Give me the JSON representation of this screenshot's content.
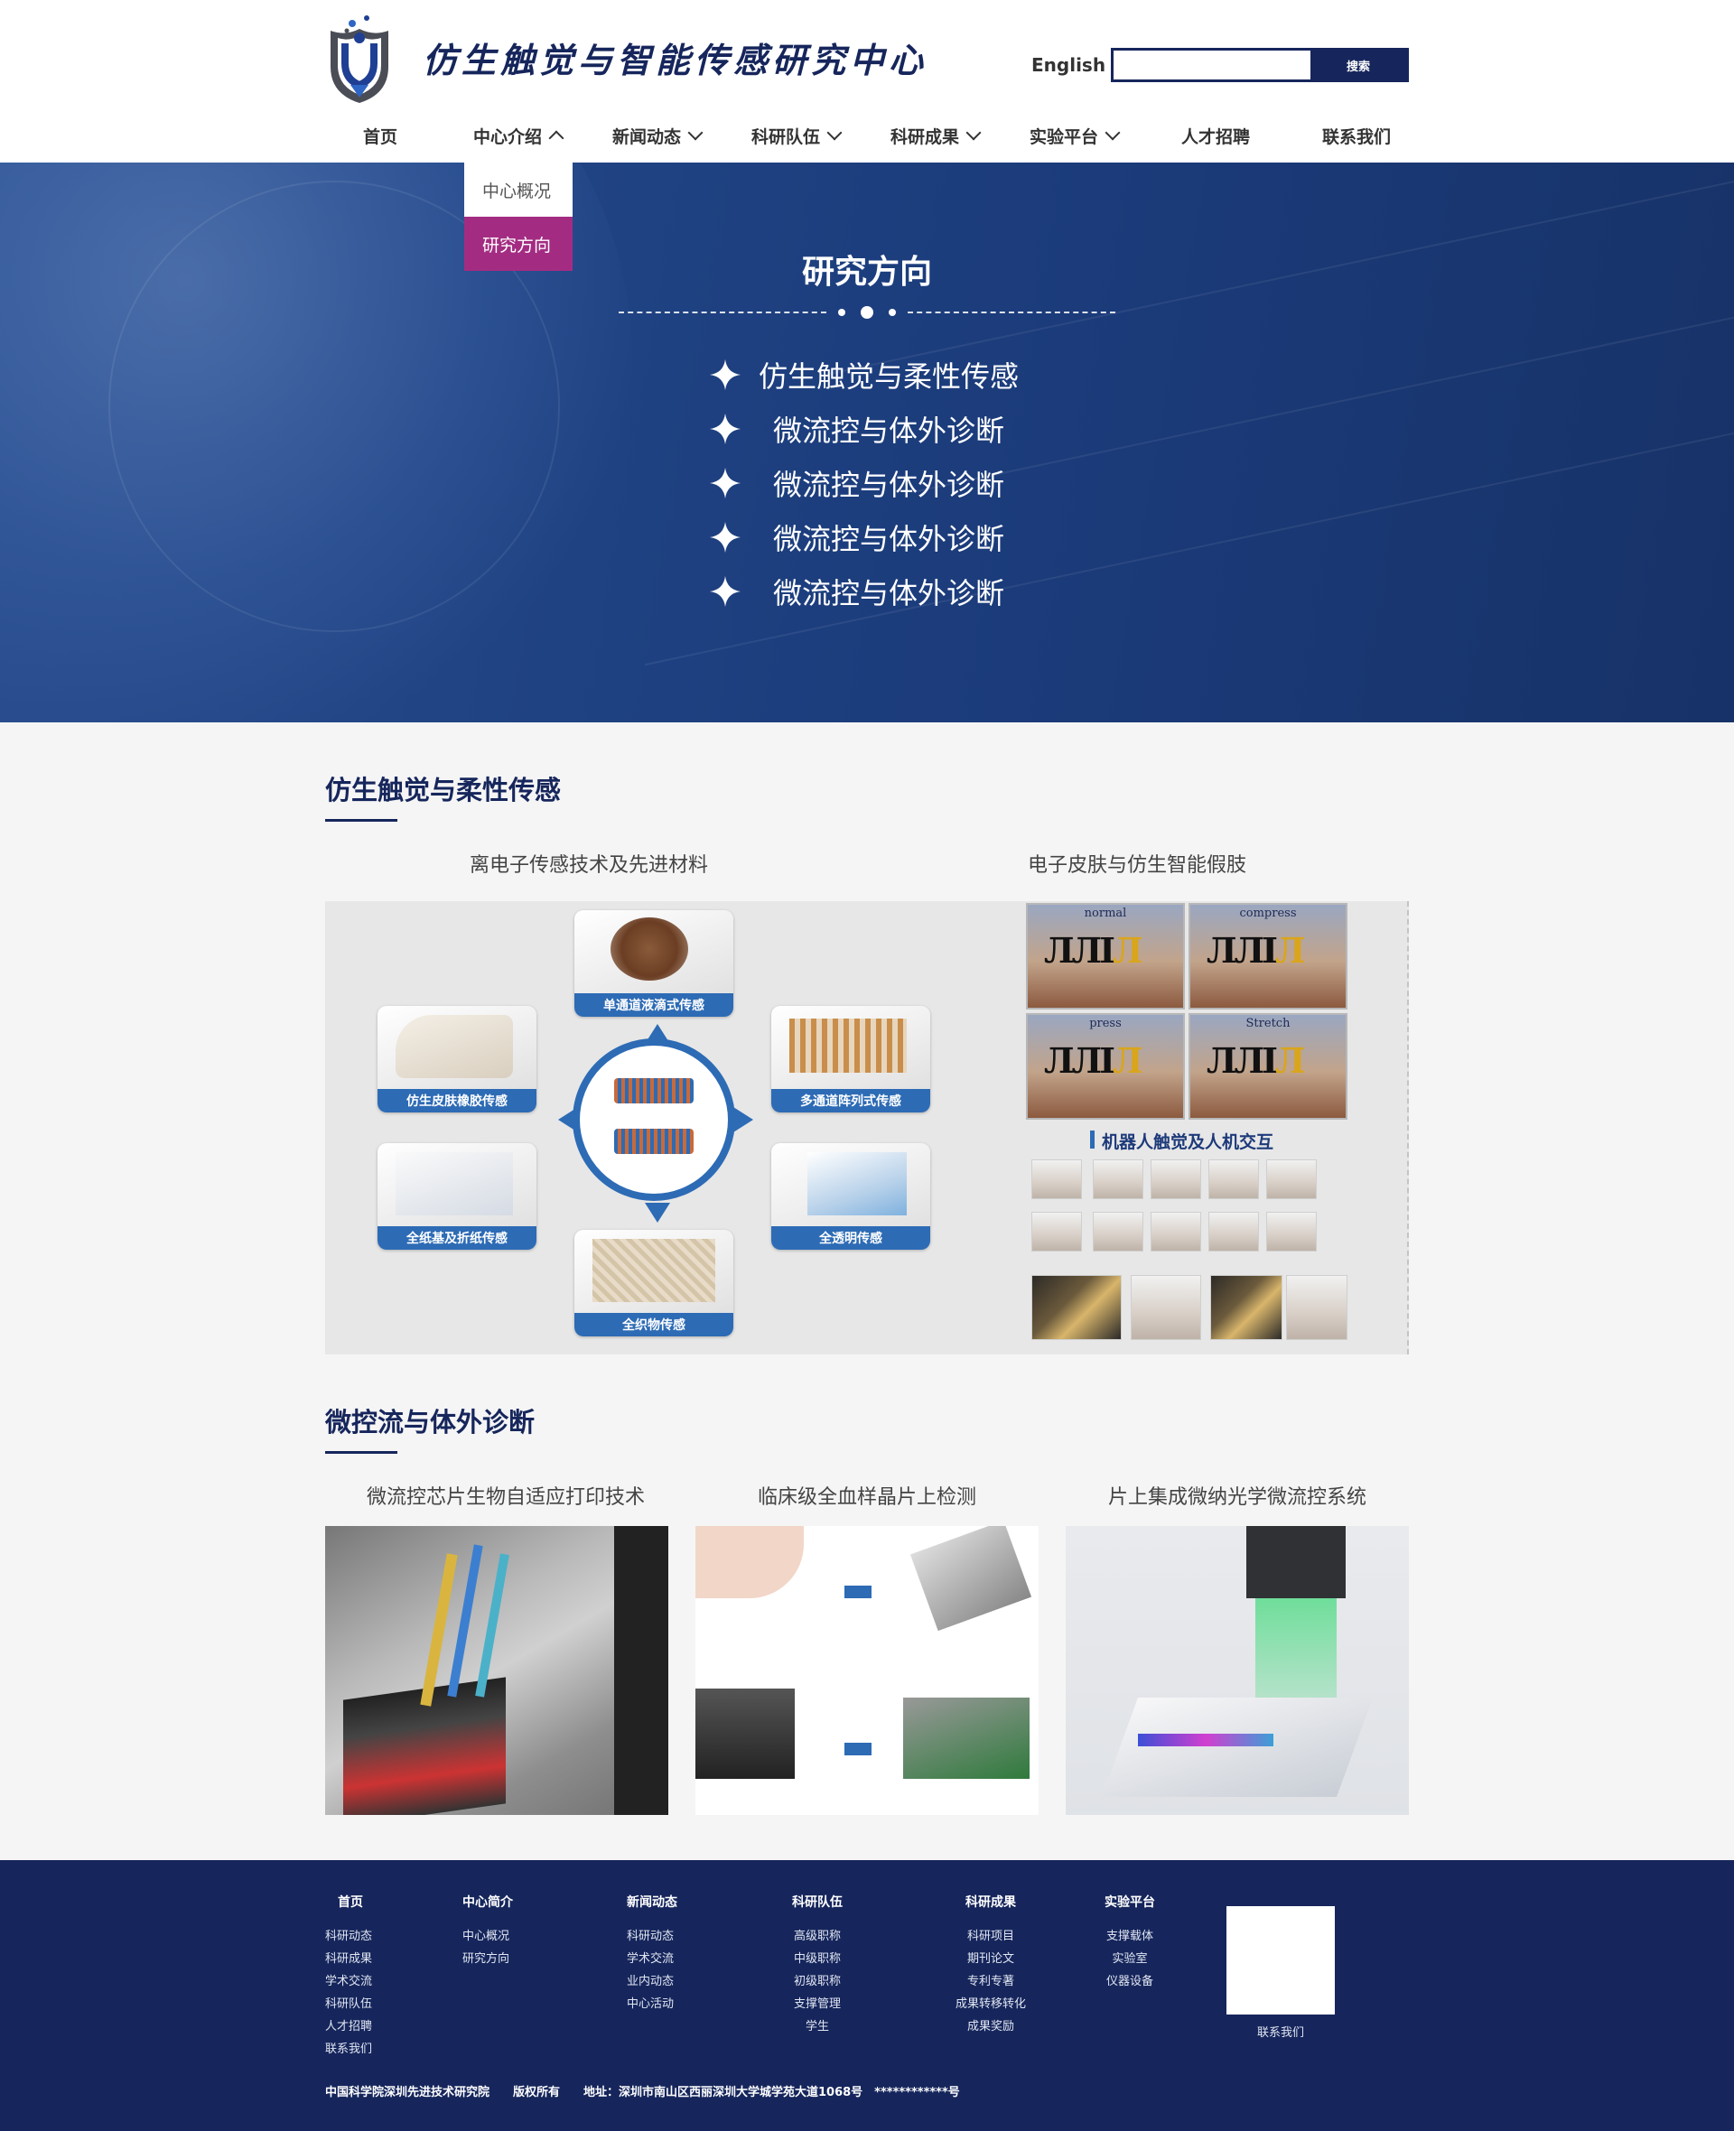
{
  "header": {
    "site_title": "仿生触觉与智能传感研究中心",
    "lang_link": "English",
    "search": {
      "value": "",
      "placeholder": "",
      "button_label": "搜索"
    }
  },
  "nav": {
    "items": [
      {
        "label": "首页",
        "has_dropdown": false
      },
      {
        "label": "中心介绍",
        "has_dropdown": true,
        "expanded": true
      },
      {
        "label": "新闻动态",
        "has_dropdown": true
      },
      {
        "label": "科研队伍",
        "has_dropdown": true
      },
      {
        "label": "科研成果",
        "has_dropdown": true
      },
      {
        "label": "实验平台",
        "has_dropdown": true
      },
      {
        "label": "人才招聘",
        "has_dropdown": false
      },
      {
        "label": "联系我们",
        "has_dropdown": false
      }
    ],
    "dropdown": [
      {
        "label": "中心概况",
        "active": false
      },
      {
        "label": "研究方向",
        "active": true
      }
    ]
  },
  "banner": {
    "title": "研究方向",
    "items": [
      "仿生触觉与柔性传感",
      "微流控与体外诊断",
      "微流控与体外诊断",
      "微流控与体外诊断",
      "微流控与体外诊断"
    ]
  },
  "section1": {
    "title": "仿生触觉与柔性传感",
    "captions": [
      "离电子传感技术及先进材料",
      "电子皮肤与仿生智能假肢"
    ],
    "figure_labels": [
      "单通道液滴式传感",
      "仿生皮肤橡胶传感",
      "多通道阵列式传感",
      "全纸基及折纸传感",
      "全透明传感",
      "全织物传感"
    ],
    "panel_labels": [
      "normal",
      "compress",
      "press",
      "Stretch"
    ],
    "robot_title": "机器人触觉及人机交互"
  },
  "section2": {
    "title": "微控流与体外诊断",
    "captions": [
      "微流控芯片生物自适应打印技术",
      "临床级全血样晶片上检测",
      "片上集成微纳光学微流控系统"
    ]
  },
  "footer": {
    "columns": [
      {
        "head": "首页",
        "links": [
          "科研动态",
          "科研成果",
          "学术交流",
          "科研队伍",
          "人才招聘",
          "联系我们"
        ]
      },
      {
        "head": "中心简介",
        "links": [
          "中心概况",
          "研究方向"
        ]
      },
      {
        "head": "新闻动态",
        "links": [
          "科研动态",
          "学术交流",
          "业内动态",
          "中心活动"
        ]
      },
      {
        "head": "科研队伍",
        "links": [
          "高级职称",
          "中级职称",
          "初级职称",
          "支撑管理",
          "学生"
        ]
      },
      {
        "head": "科研成果",
        "links": [
          "科研项目",
          "期刊论文",
          "专利专著",
          "成果转移转化",
          "成果奖励"
        ]
      },
      {
        "head": "实验平台",
        "links": [
          "支撑载体",
          "实验室",
          "仪器设备"
        ]
      }
    ],
    "qr_label": "联系我们",
    "copyright": "中国科学院深圳先进技术研究院　　版权所有　　地址：深圳市南山区西丽深圳大学城学苑大道1068号　************号"
  },
  "colors": {
    "navy": "#16265c",
    "banner_blue": "#1f4282",
    "dropdown_active": "#a32c82",
    "accent_blue": "#2d6bb5"
  },
  "icons": {
    "nav_expand": "chevron-down-icon",
    "nav_collapse": "chevron-up-icon",
    "list_marker": "sparkle-star-icon",
    "logo": "shield-logo-icon"
  }
}
